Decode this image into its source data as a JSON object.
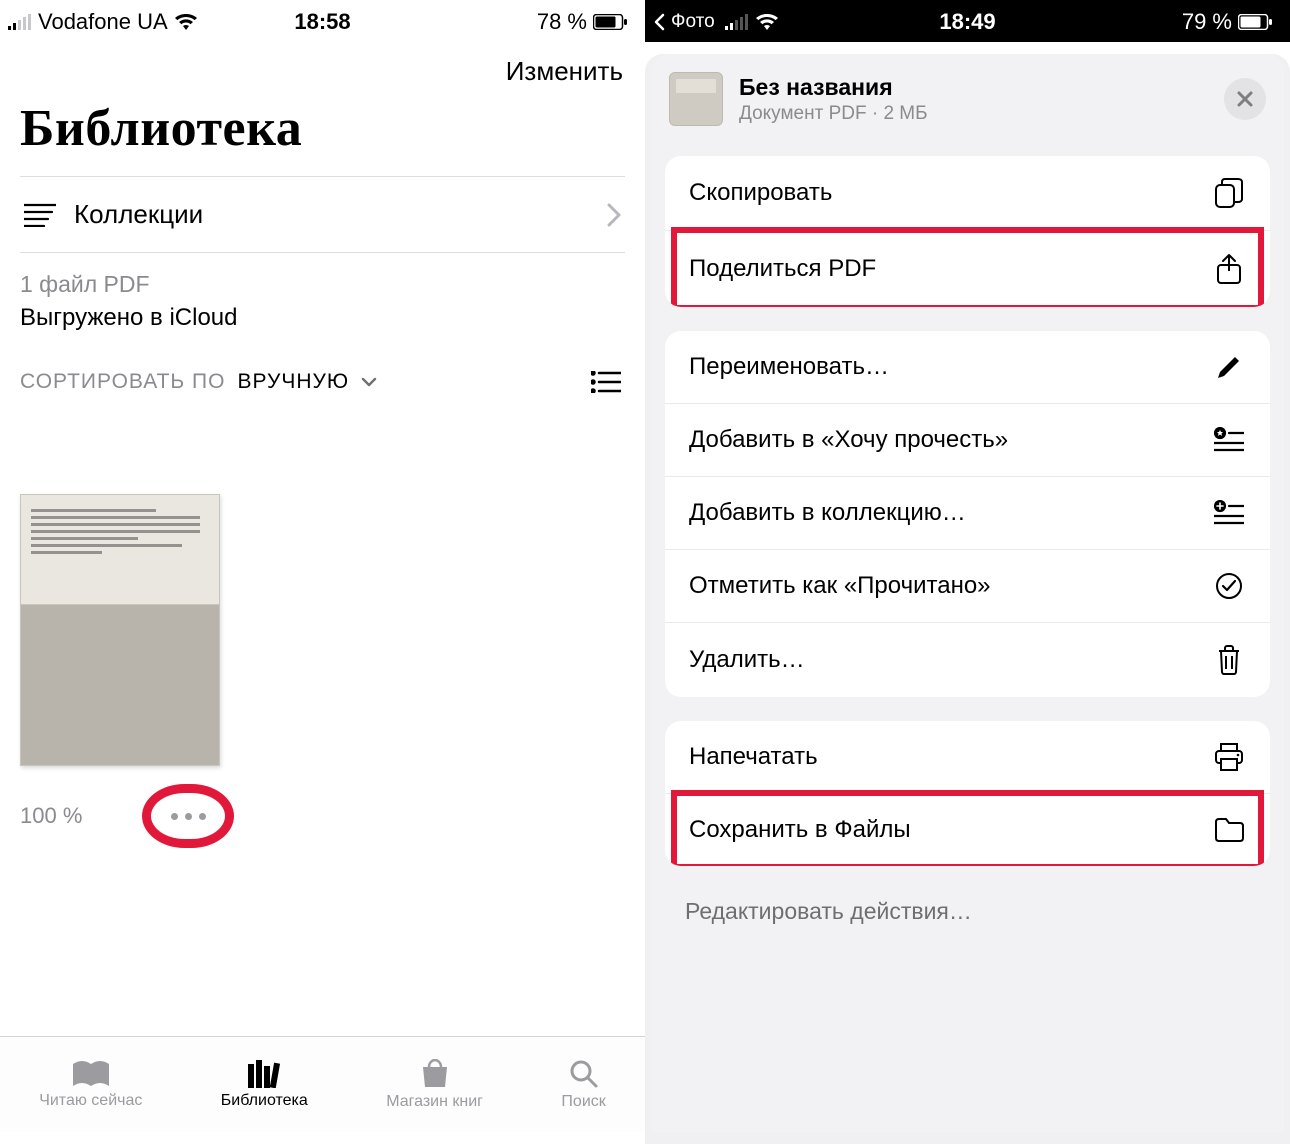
{
  "left": {
    "status": {
      "carrier": "Vodafone UA",
      "time": "18:58",
      "battery": "78 %"
    },
    "edit_label": "Изменить",
    "title": "Библиотека",
    "collections_label": "Коллекции",
    "meta_gray": "1 файл PDF",
    "meta_black": "Выгружено в iCloud",
    "sort_label": "СОРТИРОВАТЬ ПО",
    "sort_value": "ВРУЧНУЮ",
    "thumb_percent": "100 %",
    "tabs": {
      "reading": "Читаю сейчас",
      "library": "Библиотека",
      "store": "Магазин книг",
      "search": "Поиск"
    }
  },
  "right": {
    "status": {
      "back": "Фото",
      "time": "18:49",
      "battery": "79 %"
    },
    "doc_title": "Без названия",
    "doc_sub": "Документ PDF · 2 МБ",
    "actions": {
      "copy": "Скопировать",
      "share": "Поделиться PDF",
      "rename": "Переименовать…",
      "wantread": "Добавить в «Хочу прочесть»",
      "collection": "Добавить в коллекцию…",
      "markread": "Отметить как «Прочитано»",
      "delete": "Удалить…",
      "print": "Напечатать",
      "save": "Сохранить в Файлы",
      "editactions": "Редактировать действия…"
    }
  }
}
